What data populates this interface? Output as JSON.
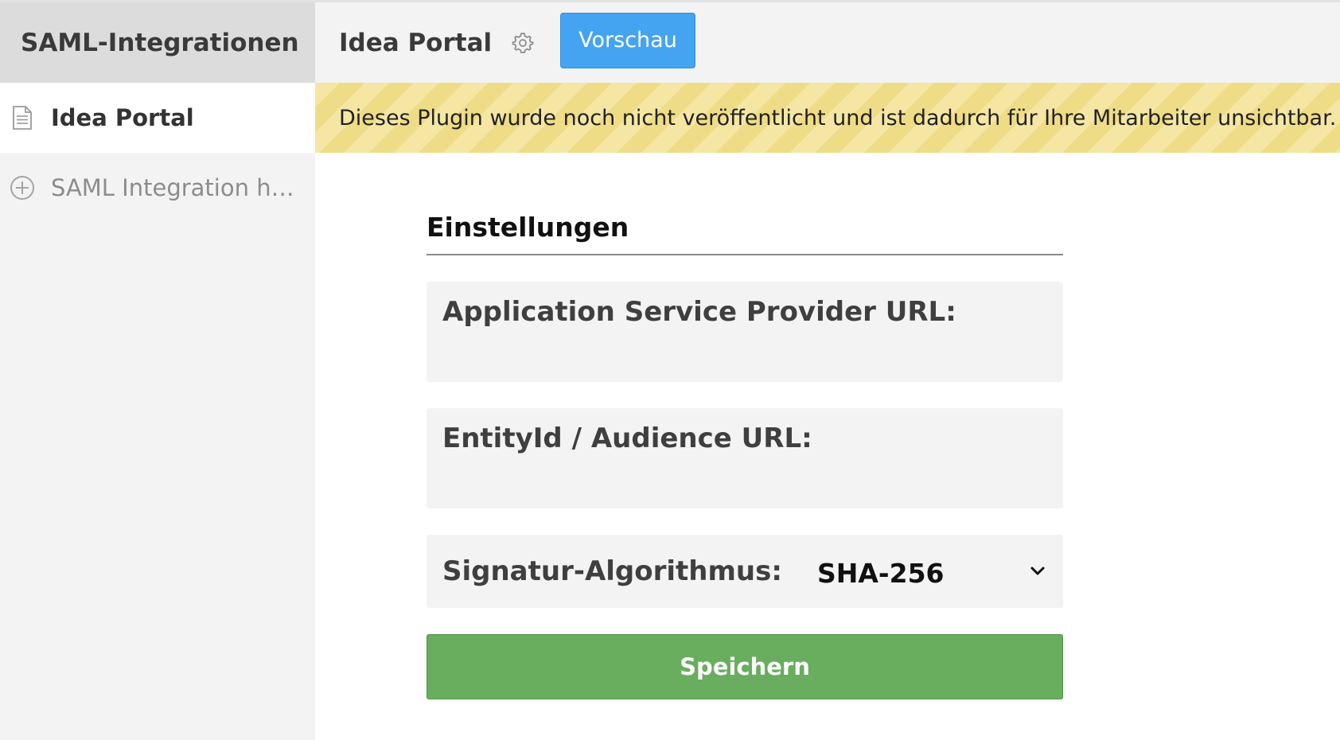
{
  "sidebar": {
    "title": "SAML-Integrationen",
    "items": [
      {
        "label": "Idea Portal",
        "icon": "document-icon",
        "active": true
      },
      {
        "label": "SAML Integration hinz...",
        "icon": "plus-circle-icon",
        "active": false
      }
    ]
  },
  "topbar": {
    "title": "Idea Portal",
    "settings_icon": "gear-icon",
    "preview_label": "Vorschau",
    "preview_color": "#44a4f2"
  },
  "banner": {
    "text": "Dieses Plugin wurde noch nicht veröffentlicht und ist dadurch für Ihre Mitarbeiter unsichtbar.",
    "color": "#f5e7a3"
  },
  "settings": {
    "section_title": "Einstellungen",
    "fields": [
      {
        "label": "Application Service Provider URL:",
        "value": ""
      },
      {
        "label": "EntityId / Audience URL:",
        "value": ""
      }
    ],
    "signature": {
      "label": "Signatur-Algorithmus:",
      "selected": "SHA-256"
    },
    "save_label": "Speichern",
    "save_color": "#69ad5e"
  }
}
